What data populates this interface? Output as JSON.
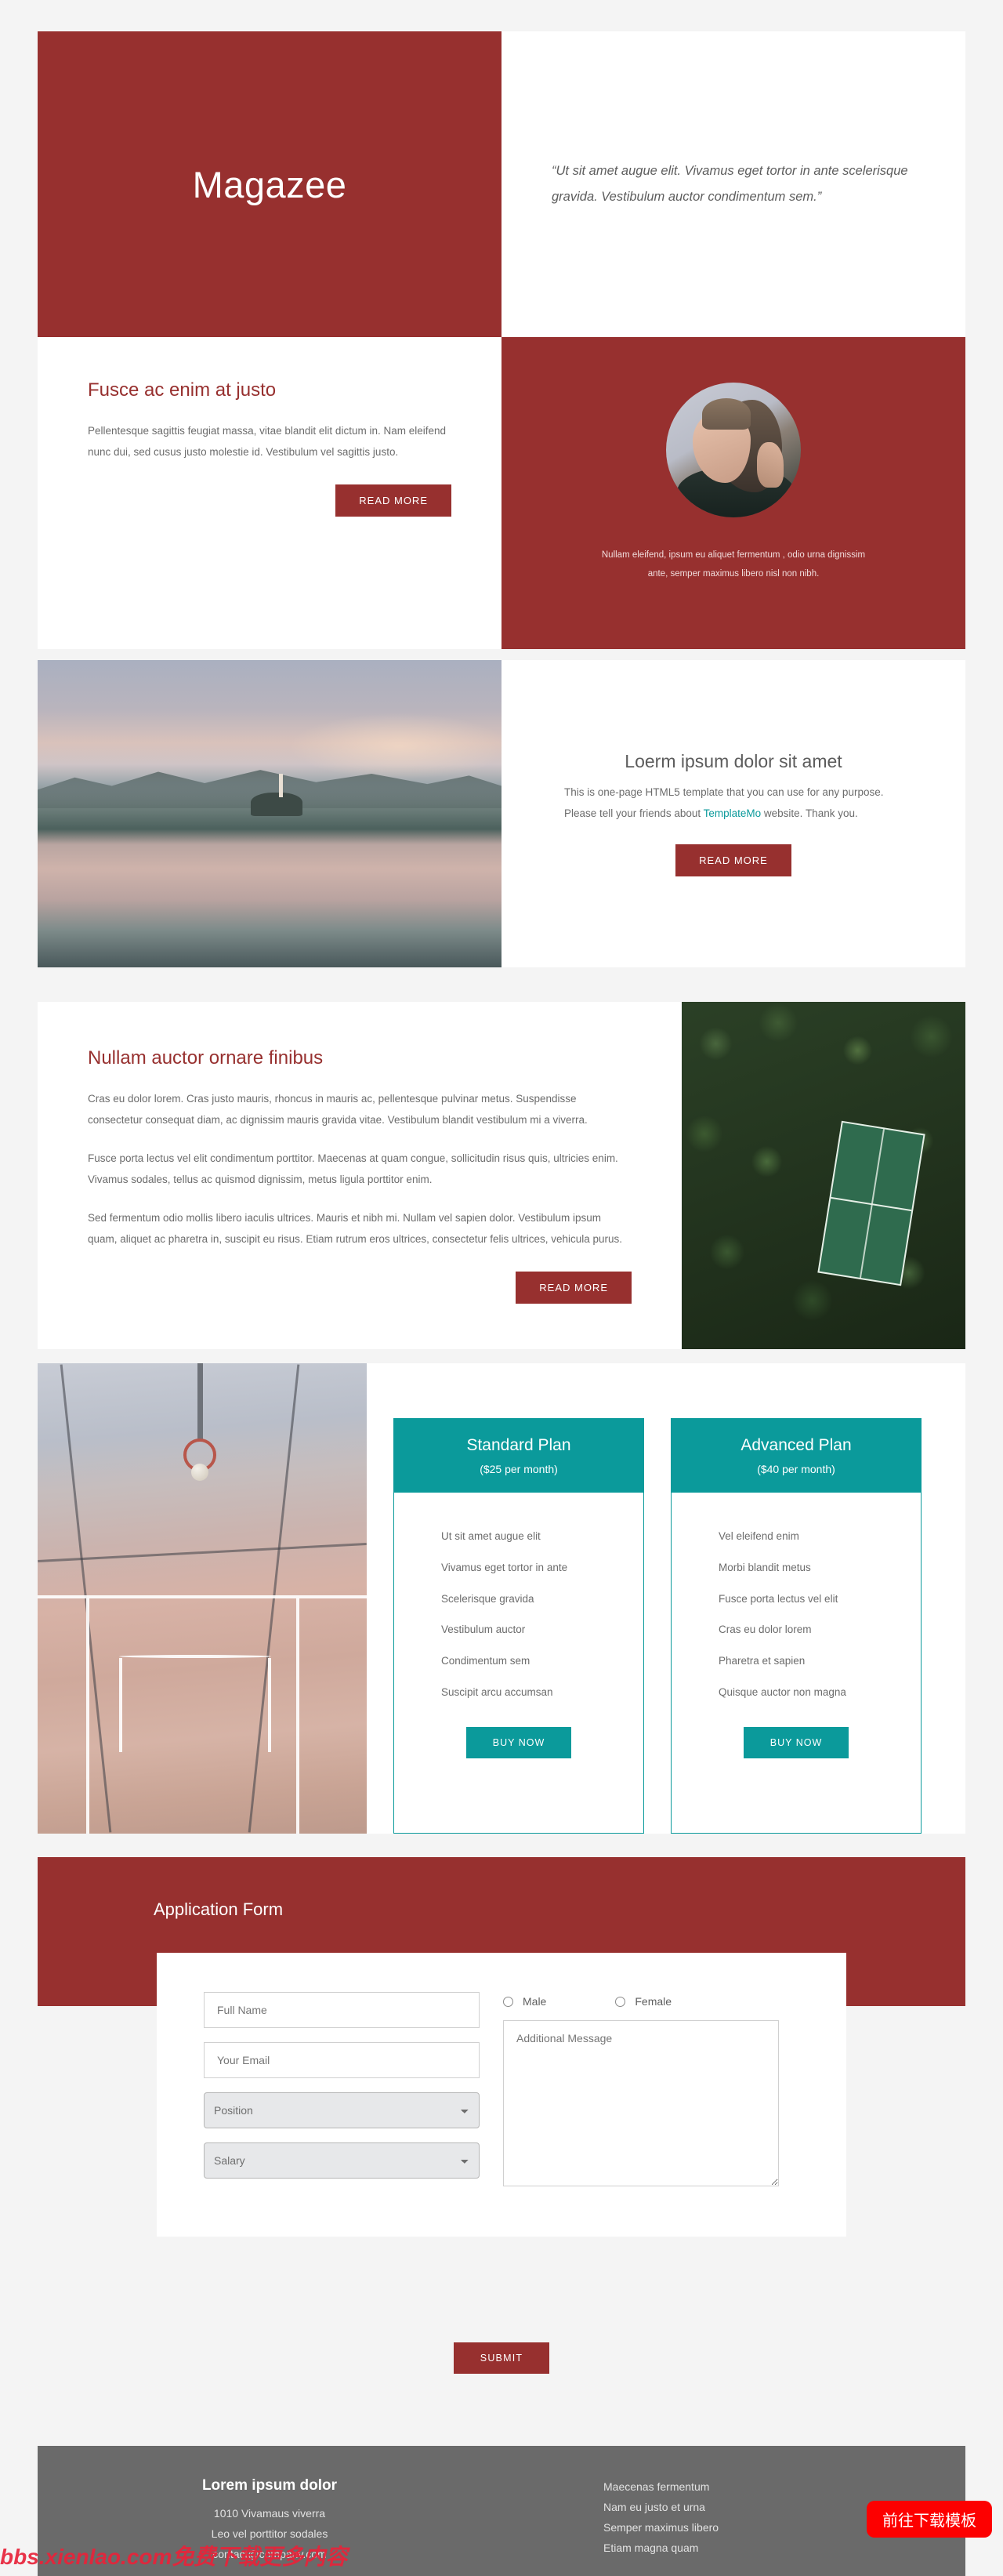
{
  "colors": {
    "brand_red": "#97302f",
    "teal": "#0b9a9b",
    "footer_gray": "#6a6a6a",
    "page_bg": "#f4f4f4",
    "download_red": "#fd0000"
  },
  "hero": {
    "title": "Magazee",
    "quote": "“Ut sit amet augue elit. Vivamus eget tortor in ante scelerisque gravida. Vestibulum auctor condimentum sem.”"
  },
  "section_two": {
    "heading": "Fusce ac enim at justo",
    "paragraph": "Pellentesque sagittis feugiat massa, vitae blandit elit dictum in. Nam eleifend nunc dui, sed cusus justo molestie id. Vestibulum vel sagittis justo.",
    "read_more": "READ MORE",
    "avatar_caption": "Nullam eleifend, ipsum eu aliquet fermentum , odio urna dignissim ante, semper maximus libero nisl non nibh."
  },
  "section_three": {
    "heading": "Loerm ipsum dolor sit amet",
    "paragraph_before": "This is one-page HTML5 template that you can use for any purpose. Please tell your friends about ",
    "link_text": "TemplateMo",
    "paragraph_after": " website. Thank you.",
    "read_more": "READ MORE"
  },
  "section_four": {
    "heading": "Nullam auctor ornare finibus",
    "paragraph_1": "Cras eu dolor lorem. Cras justo mauris, rhoncus in mauris ac, pellentesque pulvinar metus. Suspendisse consectetur consequat diam, ac dignissim mauris gravida vitae. Vestibulum blandit vestibulum mi a viverra.",
    "paragraph_2": "Fusce porta lectus vel elit condimentum porttitor. Maecenas at quam congue, sollicitudin risus quis, ultricies enim. Vivamus sodales, tellus ac quismod dignissim, metus ligula porttitor enim.",
    "paragraph_3": "Sed fermentum odio mollis libero iaculis ultrices. Mauris et nibh mi. Nullam vel sapien dolor. Vestibulum ipsum quam, aliquet ac pharetra in, suscipit eu risus. Etiam rutrum eros ultrices, consectetur felis ultrices, vehicula purus.",
    "read_more": "READ MORE"
  },
  "pricing": {
    "plans": [
      {
        "name": "Standard Plan",
        "price": "($25 per month)",
        "features": [
          "Ut sit amet augue elit",
          "Vivamus eget tortor in ante",
          "Scelerisque gravida",
          "Vestibulum auctor",
          "Condimentum sem",
          "Suscipit arcu accumsan"
        ],
        "buy_label": "BUY NOW"
      },
      {
        "name": "Advanced Plan",
        "price": "($40 per month)",
        "features": [
          "Vel eleifend enim",
          "Morbi blandit metus",
          "Fusce porta lectus vel elit",
          "Cras eu dolor lorem",
          "Pharetra et sapien",
          "Quisque auctor non magna"
        ],
        "buy_label": "BUY NOW"
      }
    ]
  },
  "form": {
    "title": "Application Form",
    "fields": {
      "full_name_placeholder": "Full Name",
      "email_placeholder": "Your Email",
      "position_value": "Position",
      "salary_value": "Salary",
      "message_placeholder": "Additional Message"
    },
    "gender": {
      "male_label": "Male",
      "female_label": "Female"
    },
    "submit_label": "SUBMIT"
  },
  "footer": {
    "title": "Lorem ipsum dolor",
    "address_line_1": "1010 Vivamaus viverra",
    "address_line_2": "Leo vel porttitor sodales",
    "address_line_3": "contact@company.com",
    "links": [
      "Maecenas fermentum",
      "Nam eu justo et urna",
      "Semper maximus libero",
      "Etiam magna quam"
    ]
  },
  "overlay": {
    "watermark": "bbs.xienlao.com免费下载更多内容",
    "download_button": "前往下载模板"
  }
}
